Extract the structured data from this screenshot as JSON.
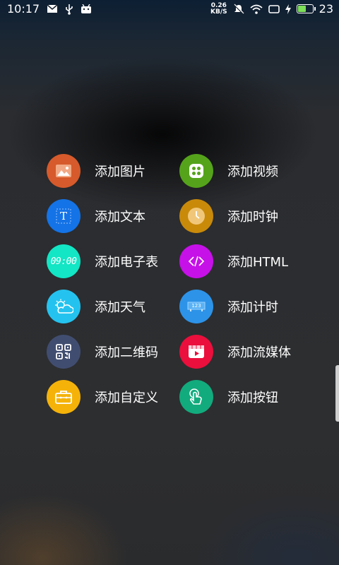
{
  "status_bar": {
    "time": "10:17",
    "net_speed_value": "0.26",
    "net_speed_unit": "KB/S",
    "battery_percent": "23",
    "battery_level": 0.23,
    "icons": [
      "message-icon",
      "usb-icon",
      "android-debug-icon",
      "mute-icon",
      "wifi-icon",
      "screen-icon",
      "charging-icon",
      "battery-icon"
    ]
  },
  "menu": {
    "items": [
      {
        "label": "添加图片",
        "icon": "image-icon",
        "color": "#d65a2b"
      },
      {
        "label": "添加视频",
        "icon": "video-icon",
        "color": "#55a31b"
      },
      {
        "label": "添加文本",
        "icon": "text-icon",
        "color": "#1473e6"
      },
      {
        "label": "添加时钟",
        "icon": "clock-icon",
        "color": "#c98a0a"
      },
      {
        "label": "添加电子表",
        "icon": "digital-clock-icon",
        "color": "#12e6c4"
      },
      {
        "label": "添加HTML",
        "icon": "html-icon",
        "color": "#c611e8"
      },
      {
        "label": "添加天气",
        "icon": "weather-icon",
        "color": "#24c3ef"
      },
      {
        "label": "添加计时",
        "icon": "timer-icon",
        "color": "#2d93e8"
      },
      {
        "label": "添加二维码",
        "icon": "qrcode-icon",
        "color": "#414d70"
      },
      {
        "label": "添加流媒体",
        "icon": "stream-icon",
        "color": "#ea0f3c"
      },
      {
        "label": "添加自定义",
        "icon": "custom-icon",
        "color": "#f5b30a"
      },
      {
        "label": "添加按钮",
        "icon": "button-icon",
        "color": "#12ab7d"
      }
    ]
  },
  "digital_clock_text": "09:00",
  "timer_text": "123"
}
